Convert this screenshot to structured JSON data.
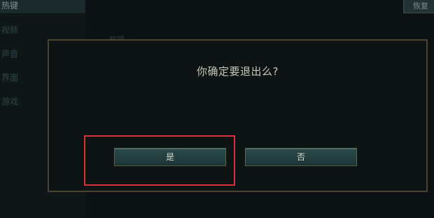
{
  "background": {
    "sidebar": {
      "items": [
        {
          "label": "热键",
          "active": true
        },
        {
          "label": "视频",
          "active": false
        },
        {
          "label": "声音",
          "active": false
        },
        {
          "label": "界面",
          "active": false
        },
        {
          "label": "游戏",
          "active": false
        }
      ]
    },
    "heading": "热键",
    "top_right_button": "恢复"
  },
  "dialog": {
    "message": "你确定要退出么?",
    "yes_label": "是",
    "no_label": "否"
  },
  "colors": {
    "dialog_border": "#4a4532",
    "button_fill": "#2b4a4b",
    "highlight": "#d8323a"
  }
}
